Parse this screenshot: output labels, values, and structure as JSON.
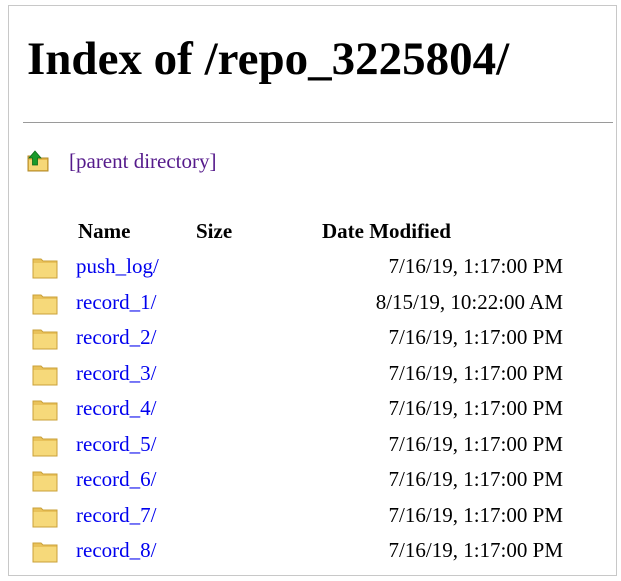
{
  "page": {
    "title": "Index of /repo_3225804/",
    "parent_link": "[parent directory]"
  },
  "columns": {
    "name": "Name",
    "size": "Size",
    "date": "Date Modified"
  },
  "entries": [
    {
      "name": "push_log/",
      "date": "7/16/19, 1:17:00 PM"
    },
    {
      "name": "record_1/",
      "date": "8/15/19, 10:22:00 AM"
    },
    {
      "name": "record_2/",
      "date": "7/16/19, 1:17:00 PM"
    },
    {
      "name": "record_3/",
      "date": "7/16/19, 1:17:00 PM"
    },
    {
      "name": "record_4/",
      "date": "7/16/19, 1:17:00 PM"
    },
    {
      "name": "record_5/",
      "date": "7/16/19, 1:17:00 PM"
    },
    {
      "name": "record_6/",
      "date": "7/16/19, 1:17:00 PM"
    },
    {
      "name": "record_7/",
      "date": "7/16/19, 1:17:00 PM"
    },
    {
      "name": "record_8/",
      "date": "7/16/19, 1:17:00 PM"
    }
  ],
  "icons": {
    "folder": "folder-icon",
    "parent": "parent-directory-icon"
  },
  "colors": {
    "link": "#0000ee",
    "visited_link": "#551a8b",
    "folder_fill": "#f4d26b",
    "up_arrow": "#1a9a2a"
  }
}
